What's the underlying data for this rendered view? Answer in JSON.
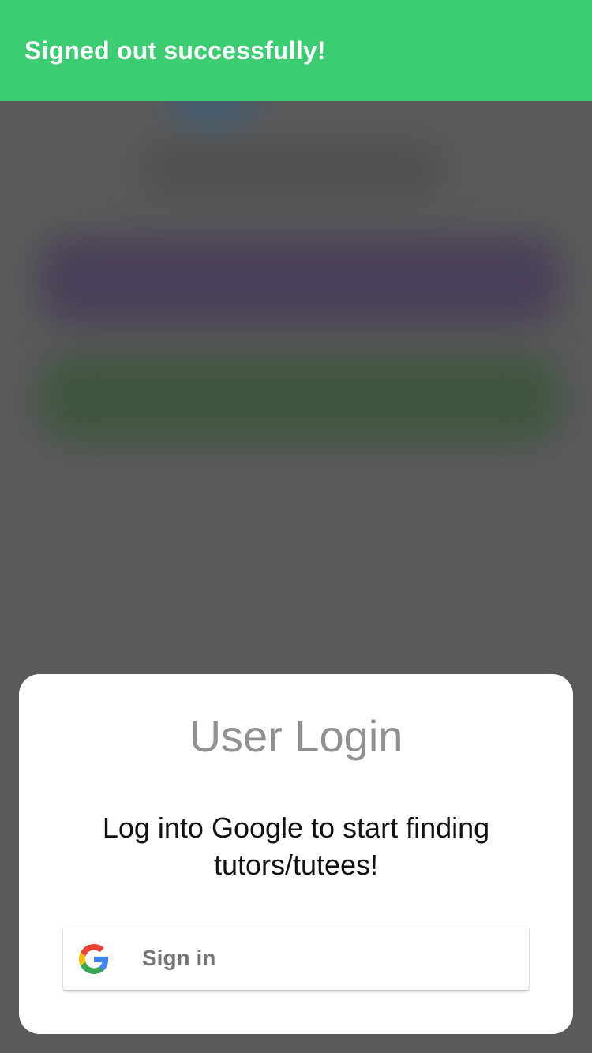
{
  "toast": {
    "message": "Signed out successfully!",
    "color": "#3acd72"
  },
  "modal": {
    "title": "User Login",
    "message_line1": "Log into Google to start finding",
    "message_line2": "tutors/tutees!",
    "signin_button": {
      "label": "Sign in",
      "icon": "google-logo-icon"
    }
  }
}
